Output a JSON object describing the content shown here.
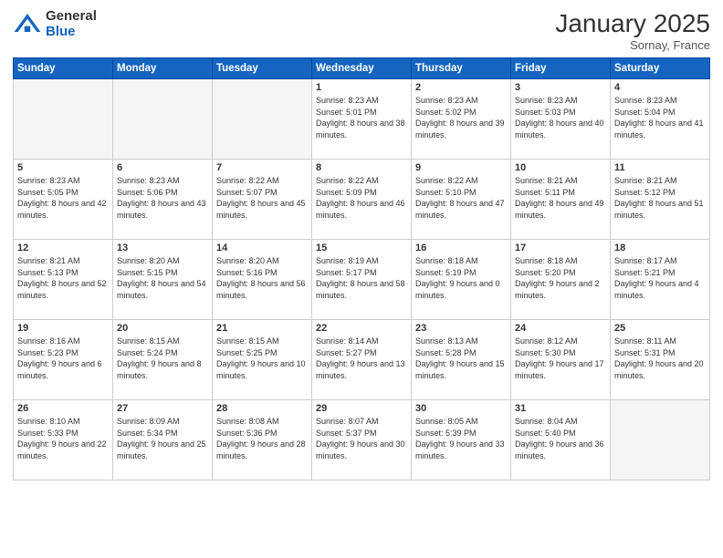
{
  "header": {
    "logo_general": "General",
    "logo_blue": "Blue",
    "month_title": "January 2025",
    "location": "Sornay, France"
  },
  "weekdays": [
    "Sunday",
    "Monday",
    "Tuesday",
    "Wednesday",
    "Thursday",
    "Friday",
    "Saturday"
  ],
  "weeks": [
    [
      {
        "day": "",
        "empty": true
      },
      {
        "day": "",
        "empty": true
      },
      {
        "day": "",
        "empty": true
      },
      {
        "day": "1",
        "sunrise": "8:23 AM",
        "sunset": "5:01 PM",
        "daylight": "8 hours and 38 minutes."
      },
      {
        "day": "2",
        "sunrise": "8:23 AM",
        "sunset": "5:02 PM",
        "daylight": "8 hours and 39 minutes."
      },
      {
        "day": "3",
        "sunrise": "8:23 AM",
        "sunset": "5:03 PM",
        "daylight": "8 hours and 40 minutes."
      },
      {
        "day": "4",
        "sunrise": "8:23 AM",
        "sunset": "5:04 PM",
        "daylight": "8 hours and 41 minutes."
      }
    ],
    [
      {
        "day": "5",
        "sunrise": "8:23 AM",
        "sunset": "5:05 PM",
        "daylight": "8 hours and 42 minutes."
      },
      {
        "day": "6",
        "sunrise": "8:23 AM",
        "sunset": "5:06 PM",
        "daylight": "8 hours and 43 minutes."
      },
      {
        "day": "7",
        "sunrise": "8:22 AM",
        "sunset": "5:07 PM",
        "daylight": "8 hours and 45 minutes."
      },
      {
        "day": "8",
        "sunrise": "8:22 AM",
        "sunset": "5:09 PM",
        "daylight": "8 hours and 46 minutes."
      },
      {
        "day": "9",
        "sunrise": "8:22 AM",
        "sunset": "5:10 PM",
        "daylight": "8 hours and 47 minutes."
      },
      {
        "day": "10",
        "sunrise": "8:21 AM",
        "sunset": "5:11 PM",
        "daylight": "8 hours and 49 minutes."
      },
      {
        "day": "11",
        "sunrise": "8:21 AM",
        "sunset": "5:12 PM",
        "daylight": "8 hours and 51 minutes."
      }
    ],
    [
      {
        "day": "12",
        "sunrise": "8:21 AM",
        "sunset": "5:13 PM",
        "daylight": "8 hours and 52 minutes."
      },
      {
        "day": "13",
        "sunrise": "8:20 AM",
        "sunset": "5:15 PM",
        "daylight": "8 hours and 54 minutes."
      },
      {
        "day": "14",
        "sunrise": "8:20 AM",
        "sunset": "5:16 PM",
        "daylight": "8 hours and 56 minutes."
      },
      {
        "day": "15",
        "sunrise": "8:19 AM",
        "sunset": "5:17 PM",
        "daylight": "8 hours and 58 minutes."
      },
      {
        "day": "16",
        "sunrise": "8:18 AM",
        "sunset": "5:19 PM",
        "daylight": "9 hours and 0 minutes."
      },
      {
        "day": "17",
        "sunrise": "8:18 AM",
        "sunset": "5:20 PM",
        "daylight": "9 hours and 2 minutes."
      },
      {
        "day": "18",
        "sunrise": "8:17 AM",
        "sunset": "5:21 PM",
        "daylight": "9 hours and 4 minutes."
      }
    ],
    [
      {
        "day": "19",
        "sunrise": "8:16 AM",
        "sunset": "5:23 PM",
        "daylight": "9 hours and 6 minutes."
      },
      {
        "day": "20",
        "sunrise": "8:15 AM",
        "sunset": "5:24 PM",
        "daylight": "9 hours and 8 minutes."
      },
      {
        "day": "21",
        "sunrise": "8:15 AM",
        "sunset": "5:25 PM",
        "daylight": "9 hours and 10 minutes."
      },
      {
        "day": "22",
        "sunrise": "8:14 AM",
        "sunset": "5:27 PM",
        "daylight": "9 hours and 13 minutes."
      },
      {
        "day": "23",
        "sunrise": "8:13 AM",
        "sunset": "5:28 PM",
        "daylight": "9 hours and 15 minutes."
      },
      {
        "day": "24",
        "sunrise": "8:12 AM",
        "sunset": "5:30 PM",
        "daylight": "9 hours and 17 minutes."
      },
      {
        "day": "25",
        "sunrise": "8:11 AM",
        "sunset": "5:31 PM",
        "daylight": "9 hours and 20 minutes."
      }
    ],
    [
      {
        "day": "26",
        "sunrise": "8:10 AM",
        "sunset": "5:33 PM",
        "daylight": "9 hours and 22 minutes."
      },
      {
        "day": "27",
        "sunrise": "8:09 AM",
        "sunset": "5:34 PM",
        "daylight": "9 hours and 25 minutes."
      },
      {
        "day": "28",
        "sunrise": "8:08 AM",
        "sunset": "5:36 PM",
        "daylight": "9 hours and 28 minutes."
      },
      {
        "day": "29",
        "sunrise": "8:07 AM",
        "sunset": "5:37 PM",
        "daylight": "9 hours and 30 minutes."
      },
      {
        "day": "30",
        "sunrise": "8:05 AM",
        "sunset": "5:39 PM",
        "daylight": "9 hours and 33 minutes."
      },
      {
        "day": "31",
        "sunrise": "8:04 AM",
        "sunset": "5:40 PM",
        "daylight": "9 hours and 36 minutes."
      },
      {
        "day": "",
        "empty": true
      }
    ]
  ]
}
